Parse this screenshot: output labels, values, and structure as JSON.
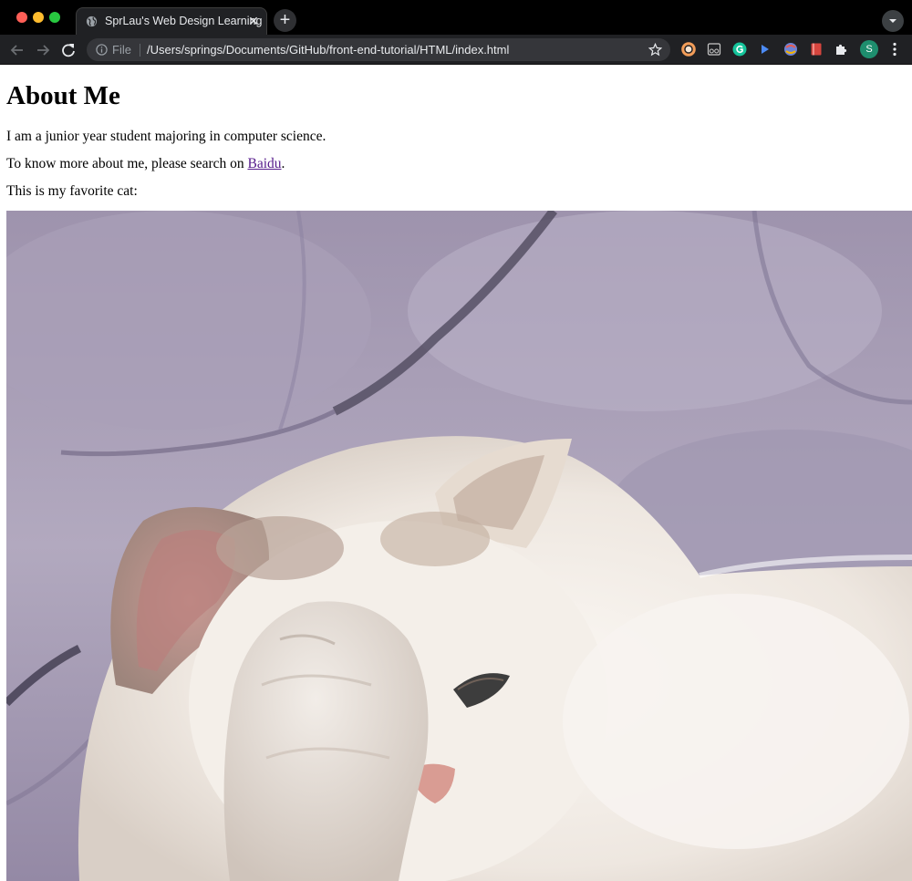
{
  "browser": {
    "tab": {
      "title": "SprLau's Web Design Learning",
      "favicon": "globe-icon"
    },
    "omnibox": {
      "scheme_label": "File",
      "url": "/Users/springs/Documents/GitHub/front-end-tutorial/HTML/index.html"
    },
    "profile_initial": "S",
    "extensions": [
      "orange-ring-extension-icon",
      "reader-extension-icon",
      "grammarly-extension-icon",
      "play-extension-icon",
      "colorful-extension-icon",
      "bookmark-extension-icon",
      "puzzle-icon"
    ]
  },
  "page": {
    "heading": "About Me",
    "intro": "I am a junior year student majoring in computer science.",
    "search_prefix": "To know more about me, please search on ",
    "search_link": "Baidu",
    "search_suffix": ".",
    "cat_caption": "This is my favorite cat:"
  },
  "colors": {
    "link_visited": "#551a8b",
    "chrome_dark": "#202124",
    "sofa_lavender": "#a79db3",
    "cat_white": "#f3eee9"
  }
}
